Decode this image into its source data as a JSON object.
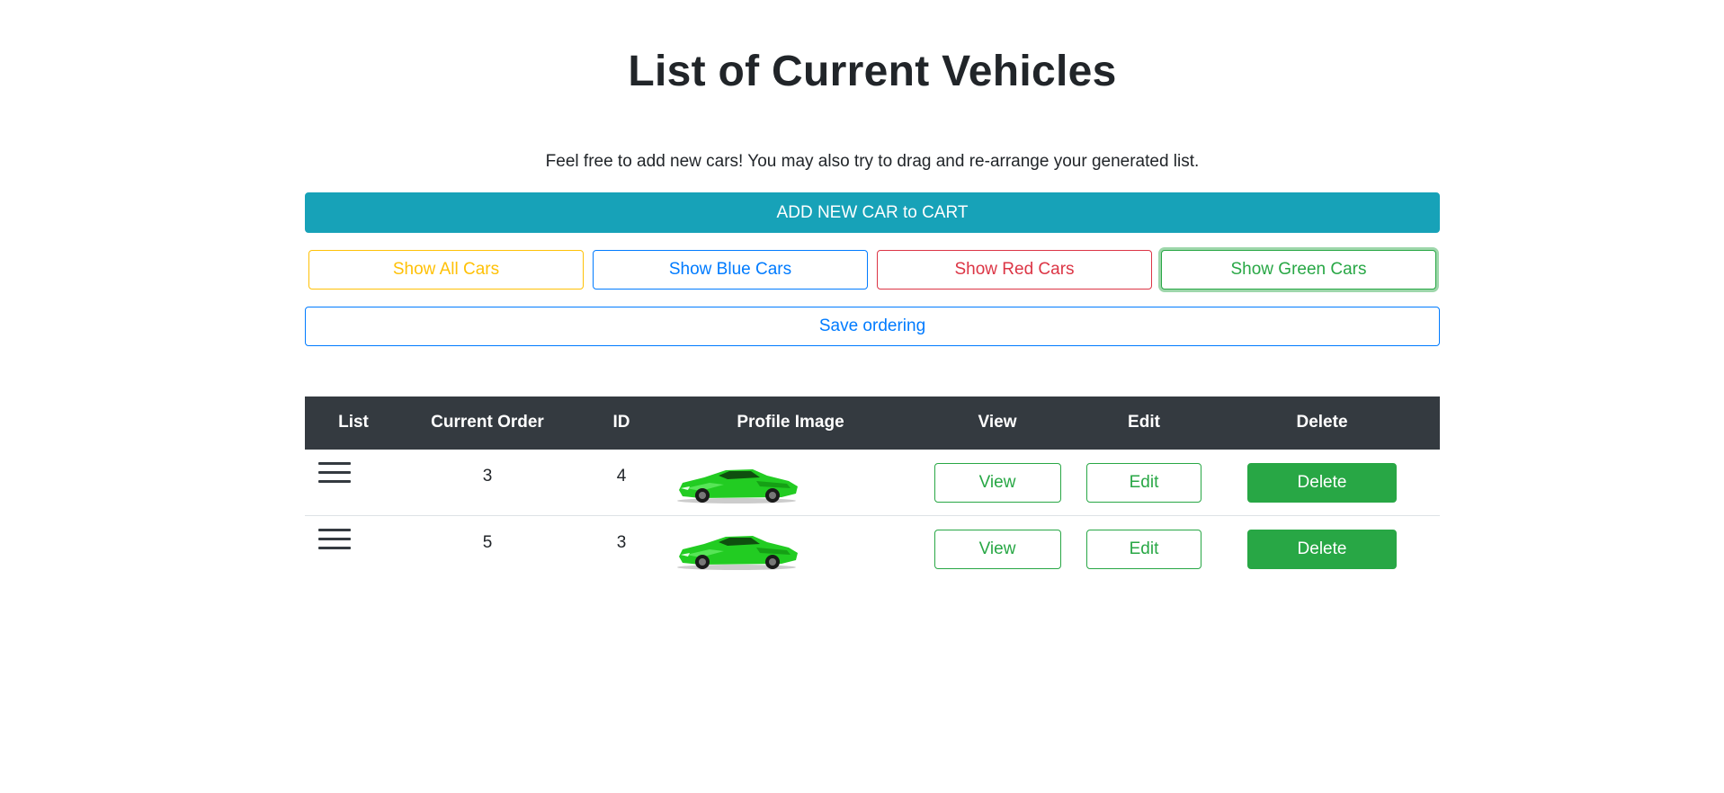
{
  "page": {
    "title": "List of Current Vehicles",
    "subtitle": "Feel free to add new cars! You may also try to drag and re-arrange your generated list."
  },
  "actions": {
    "add_label": "ADD NEW CAR to CART",
    "save_label": "Save ordering"
  },
  "filters": {
    "all": "Show All Cars",
    "blue": "Show Blue Cars",
    "red": "Show Red Cars",
    "green": "Show Green Cars",
    "active": "green"
  },
  "table": {
    "headers": {
      "list": "List",
      "order": "Current Order",
      "id": "ID",
      "image": "Profile Image",
      "view": "View",
      "edit": "Edit",
      "delete": "Delete"
    },
    "rows": [
      {
        "order": "3",
        "id": "4",
        "image_icon": "green-sports-car-image",
        "view": "View",
        "edit": "Edit",
        "delete": "Delete"
      },
      {
        "order": "5",
        "id": "3",
        "image_icon": "green-sports-car-image",
        "view": "View",
        "edit": "Edit",
        "delete": "Delete"
      }
    ]
  },
  "colors": {
    "info": "#17a2b8",
    "warning": "#ffc107",
    "primary": "#007bff",
    "danger": "#dc3545",
    "success": "#28a745",
    "dark": "#343a40",
    "car": "#22cc22"
  }
}
